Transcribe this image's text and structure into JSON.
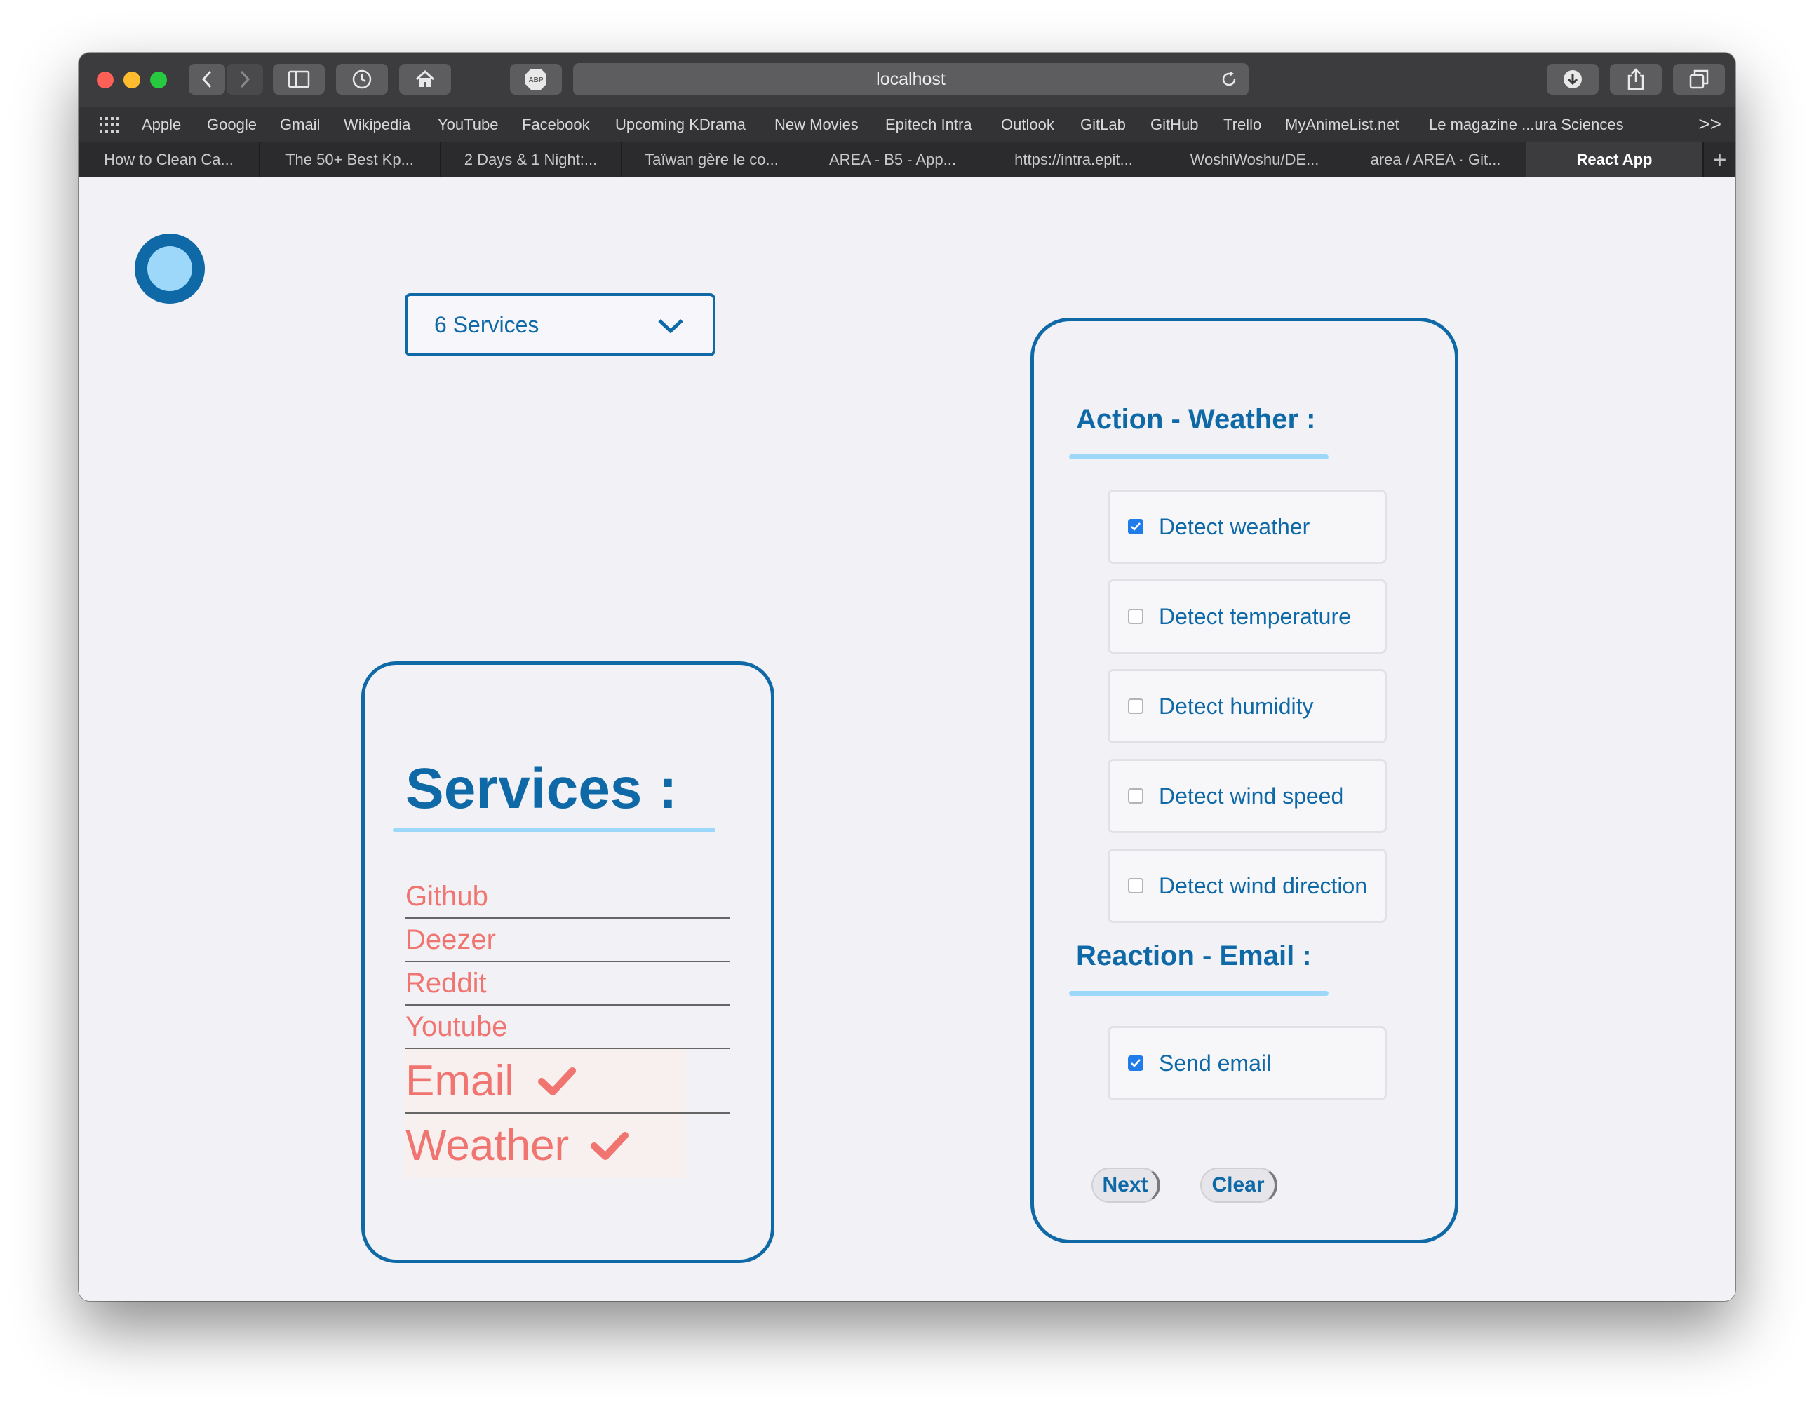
{
  "browser": {
    "url": "localhost",
    "bookmarks": [
      "Apple",
      "Google",
      "Gmail",
      "Wikipedia",
      "YouTube",
      "Facebook",
      "Upcoming KDrama",
      "New Movies",
      "Epitech Intra",
      "Outlook",
      "GitLab",
      "GitHub",
      "Trello",
      "MyAnimeList.net",
      "Le magazine ...ura Sciences"
    ],
    "bookmarks_more": ">>",
    "tabs": [
      "How to Clean Ca...",
      "The 50+ Best Kp...",
      "2 Days & 1 Night:...",
      "Taïwan gère le co...",
      "AREA - B5 - App...",
      "https://intra.epit...",
      "WoshiWoshu/DE...",
      "area / AREA · Git...",
      "React App"
    ],
    "active_tab_index": 8,
    "new_tab_label": "+"
  },
  "dropdown": {
    "selected": "6 Services"
  },
  "services_panel": {
    "title": "Services :",
    "items": [
      {
        "label": "Github",
        "selected": false
      },
      {
        "label": "Deezer",
        "selected": false
      },
      {
        "label": "Reddit",
        "selected": false
      },
      {
        "label": "Youtube",
        "selected": false
      },
      {
        "label": "Email",
        "selected": true
      },
      {
        "label": "Weather",
        "selected": true
      }
    ]
  },
  "action_panel": {
    "action_title": "Action - Weather :",
    "actions": [
      {
        "label": "Detect weather",
        "checked": true
      },
      {
        "label": "Detect temperature",
        "checked": false
      },
      {
        "label": "Detect humidity",
        "checked": false
      },
      {
        "label": "Detect wind speed",
        "checked": false
      },
      {
        "label": "Detect wind direction",
        "checked": false
      }
    ],
    "reaction_title": "Reaction - Email :",
    "reactions": [
      {
        "label": "Send email",
        "checked": true
      }
    ],
    "next_label": "Next",
    "clear_label": "Clear"
  },
  "colors": {
    "brand_blue": "#0f69a7",
    "light_blue": "#9dd8fb",
    "service_red": "#f07470",
    "checkbox_blue": "#1f7ce8"
  }
}
